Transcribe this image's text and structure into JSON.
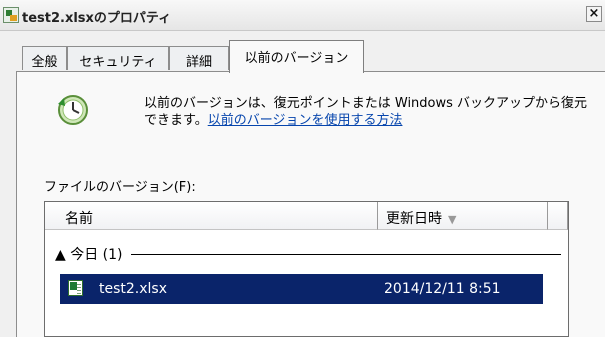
{
  "window": {
    "title": "test2.xlsx のプロパティ",
    "title_display": "test2.xlsxのプロパティ",
    "close_glyph": "×"
  },
  "tabs": [
    {
      "label": "全般",
      "active": false
    },
    {
      "label": "セキュリティ",
      "active": false
    },
    {
      "label": "詳細",
      "active": false
    },
    {
      "label": "以前のバージョン",
      "active": true
    }
  ],
  "info": {
    "text": "以前のバージョンは、復元ポイントまたは Windows バックアップから復元できます。",
    "link": "以前のバージョンを使用する方法"
  },
  "list": {
    "label": "ファイルのバージョン(F):",
    "columns": [
      {
        "label": "名前"
      },
      {
        "label": "更新日時"
      },
      {
        "label": ""
      }
    ],
    "sort_indicator": "▼",
    "group": {
      "label": "▲ 今日 (1)"
    },
    "rows": [
      {
        "name": "test2.xlsx",
        "date": "2014/12/11 8:51",
        "selected": true
      }
    ]
  },
  "colors": {
    "selection": "#0a246a",
    "link": "#0645ad"
  }
}
